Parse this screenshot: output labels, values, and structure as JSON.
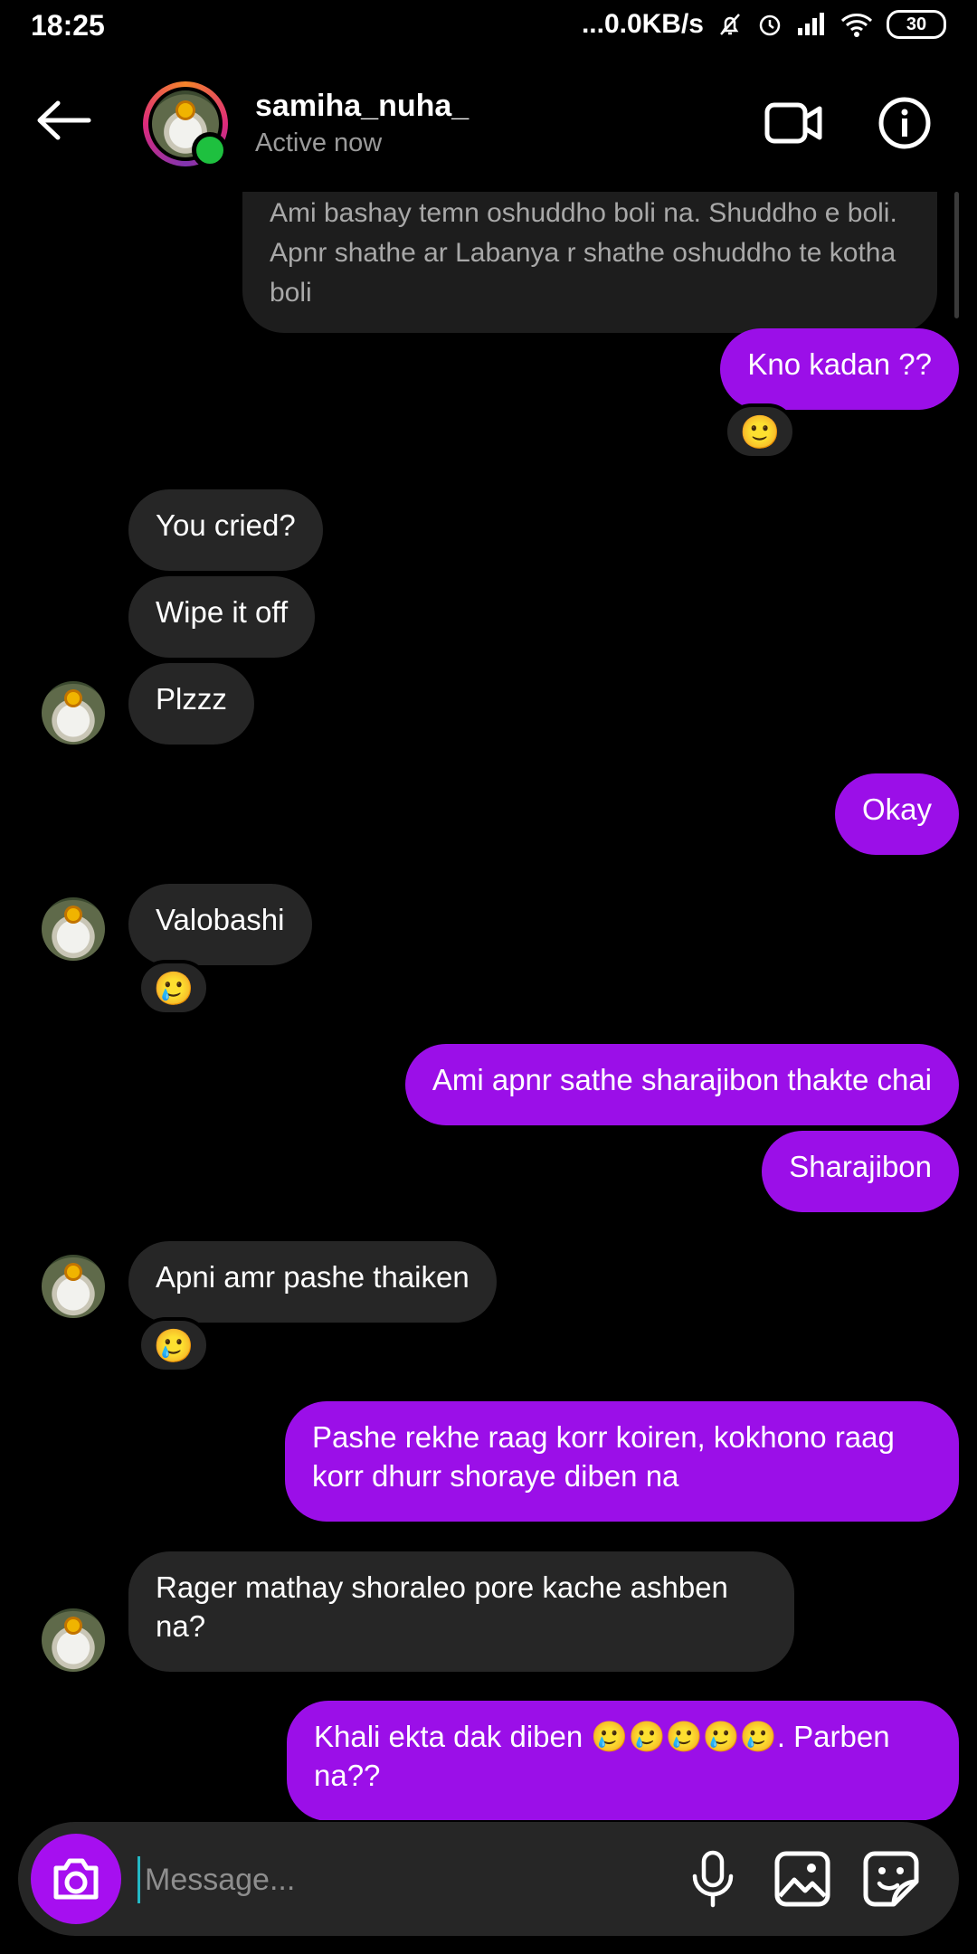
{
  "status_bar": {
    "time": "18:25",
    "network_speed": "...0.0KB/s",
    "battery": "30"
  },
  "header": {
    "username": "samiha_nuha_",
    "presence": "Active now"
  },
  "messages": [
    {
      "type": "received",
      "text": "Ami bashay temn oshuddho boli na. Shuddho e boli.\nApnr shathe ar Labanya r shathe oshuddho te kotha\nboli"
    },
    {
      "type": "sent",
      "text": "Kno kadan ??",
      "reaction": "🙂"
    },
    {
      "type": "received",
      "text": "You cried?"
    },
    {
      "type": "received",
      "text": "Wipe it off"
    },
    {
      "type": "received",
      "text": "Plzzz"
    },
    {
      "type": "sent",
      "text": "Okay"
    },
    {
      "type": "received",
      "text": "Valobashi",
      "reaction": "🥲"
    },
    {
      "type": "sent",
      "text": "Ami apnr sathe sharajibon thakte chai"
    },
    {
      "type": "sent",
      "text": "Sharajibon"
    },
    {
      "type": "received",
      "text": "Apni amr pashe thaiken",
      "reaction": "🥲"
    },
    {
      "type": "sent",
      "text": "Pashe rekhe raag korr koiren, kokhono raag\nkorr dhurr shoraye diben na"
    },
    {
      "type": "received",
      "text": "Rager mathay shoraleo pore kache ashben\nna?"
    },
    {
      "type": "sent",
      "text": "Khali ekta dak diben 🥲🥲🥲🥲🥲. Parben\nna??"
    }
  ],
  "composer": {
    "placeholder": "Message..."
  },
  "colors": {
    "sent_bubble": "#9b0fe8",
    "received_bubble": "#262626",
    "online": "#1ec03f",
    "background": "#000000"
  }
}
